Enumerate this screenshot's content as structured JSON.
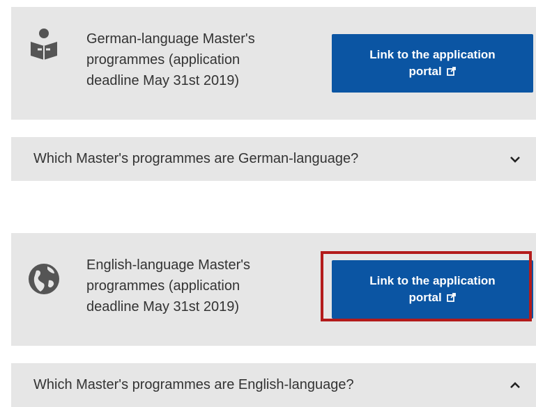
{
  "sections": [
    {
      "icon": "reader-person-icon",
      "text_lines": [
        "German-language Master's",
        "programmes (application",
        "deadline May 31st 2019)"
      ],
      "button_label": "Link to the application",
      "button_label_line2": "portal",
      "accordion_title": "Which Master's programmes are German-language?",
      "accordion_state": "collapsed"
    },
    {
      "icon": "globe-icon",
      "text_lines": [
        "English-language Master's",
        "programmes (application",
        "deadline May 31st 2019)"
      ],
      "button_label": "Link to the application",
      "button_label_line2": "portal",
      "accordion_title": "Which Master's programmes are English-language?",
      "accordion_state": "expanded"
    }
  ],
  "colors": {
    "panel_bg": "#e6e6e6",
    "button_bg": "#0b55a3",
    "highlight": "#b31b1b",
    "text": "#333333"
  }
}
